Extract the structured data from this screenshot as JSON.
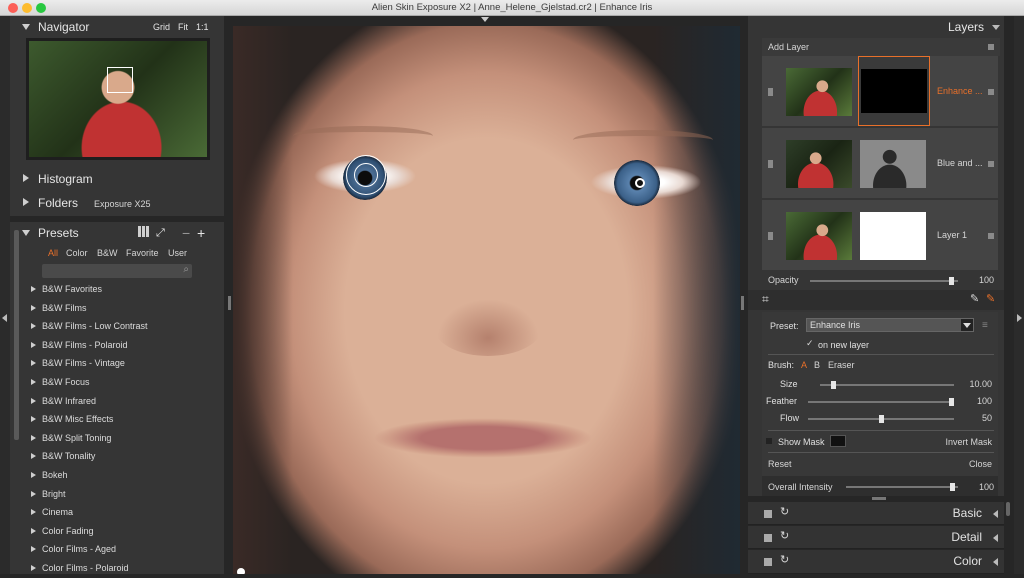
{
  "window": {
    "title": "Alien Skin Exposure X2 | Anne_Helene_Gjelstad.cr2 | Enhance Iris"
  },
  "navigator": {
    "title": "Navigator",
    "grid": "Grid",
    "fit": "Fit",
    "one_to_one": "1:1"
  },
  "histogram": {
    "title": "Histogram"
  },
  "folders": {
    "title": "Folders",
    "value": "Exposure X25"
  },
  "presets": {
    "title": "Presets",
    "filters": [
      "All",
      "Color",
      "B&W",
      "Favorite",
      "User"
    ],
    "active_filter": "All",
    "search_placeholder": "",
    "items": [
      "B&W Favorites",
      "B&W Films",
      "B&W Films - Low Contrast",
      "B&W Films - Polaroid",
      "B&W Films - Vintage",
      "B&W Focus",
      "B&W Infrared",
      "B&W Misc Effects",
      "B&W Split Toning",
      "B&W Tonality",
      "Bokeh",
      "Bright",
      "Cinema",
      "Color Fading",
      "Color Films - Aged",
      "Color Films - Polaroid"
    ]
  },
  "layers": {
    "title": "Layers",
    "add_layer": "Add Layer",
    "items": [
      {
        "name": "Enhance ..."
      },
      {
        "name": "Blue and ..."
      },
      {
        "name": "Layer 1"
      }
    ],
    "opacity_label": "Opacity",
    "opacity_value": "100",
    "opacity_level": 0.95
  },
  "brush": {
    "preset_label": "Preset:",
    "preset_value": "Enhance Iris",
    "on_new_layer": "on new layer",
    "check": "✓",
    "brush_label": "Brush:",
    "brush_a": "A",
    "brush_b": "B",
    "eraser": "Eraser",
    "size_label": "Size",
    "size_value": "10.00",
    "size_level": 0.1,
    "feather_label": "Feather",
    "feather_value": "100",
    "feather_level": 1.0,
    "flow_label": "Flow",
    "flow_value": "50",
    "flow_level": 0.5,
    "show_mask": "Show Mask",
    "invert_mask": "Invert Mask",
    "reset": "Reset",
    "close": "Close",
    "overall_label": "Overall Intensity",
    "overall_value": "100",
    "overall_level": 0.95
  },
  "sections": {
    "basic": "Basic",
    "detail": "Detail",
    "color": "Color"
  },
  "colors": {
    "accent": "#e8702a",
    "panel": "#353535",
    "bg": "#262626"
  }
}
